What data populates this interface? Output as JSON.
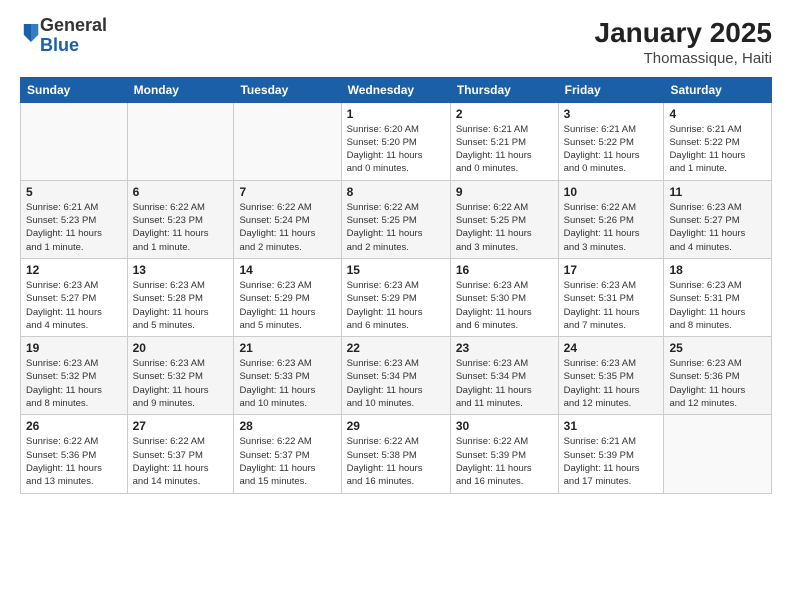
{
  "header": {
    "logo_general": "General",
    "logo_blue": "Blue",
    "title": "January 2025",
    "subtitle": "Thomassique, Haiti"
  },
  "days_of_week": [
    "Sunday",
    "Monday",
    "Tuesday",
    "Wednesday",
    "Thursday",
    "Friday",
    "Saturday"
  ],
  "weeks": [
    [
      {
        "day": "",
        "detail": ""
      },
      {
        "day": "",
        "detail": ""
      },
      {
        "day": "",
        "detail": ""
      },
      {
        "day": "1",
        "detail": "Sunrise: 6:20 AM\nSunset: 5:20 PM\nDaylight: 11 hours\nand 0 minutes."
      },
      {
        "day": "2",
        "detail": "Sunrise: 6:21 AM\nSunset: 5:21 PM\nDaylight: 11 hours\nand 0 minutes."
      },
      {
        "day": "3",
        "detail": "Sunrise: 6:21 AM\nSunset: 5:22 PM\nDaylight: 11 hours\nand 0 minutes."
      },
      {
        "day": "4",
        "detail": "Sunrise: 6:21 AM\nSunset: 5:22 PM\nDaylight: 11 hours\nand 1 minute."
      }
    ],
    [
      {
        "day": "5",
        "detail": "Sunrise: 6:21 AM\nSunset: 5:23 PM\nDaylight: 11 hours\nand 1 minute."
      },
      {
        "day": "6",
        "detail": "Sunrise: 6:22 AM\nSunset: 5:23 PM\nDaylight: 11 hours\nand 1 minute."
      },
      {
        "day": "7",
        "detail": "Sunrise: 6:22 AM\nSunset: 5:24 PM\nDaylight: 11 hours\nand 2 minutes."
      },
      {
        "day": "8",
        "detail": "Sunrise: 6:22 AM\nSunset: 5:25 PM\nDaylight: 11 hours\nand 2 minutes."
      },
      {
        "day": "9",
        "detail": "Sunrise: 6:22 AM\nSunset: 5:25 PM\nDaylight: 11 hours\nand 3 minutes."
      },
      {
        "day": "10",
        "detail": "Sunrise: 6:22 AM\nSunset: 5:26 PM\nDaylight: 11 hours\nand 3 minutes."
      },
      {
        "day": "11",
        "detail": "Sunrise: 6:23 AM\nSunset: 5:27 PM\nDaylight: 11 hours\nand 4 minutes."
      }
    ],
    [
      {
        "day": "12",
        "detail": "Sunrise: 6:23 AM\nSunset: 5:27 PM\nDaylight: 11 hours\nand 4 minutes."
      },
      {
        "day": "13",
        "detail": "Sunrise: 6:23 AM\nSunset: 5:28 PM\nDaylight: 11 hours\nand 5 minutes."
      },
      {
        "day": "14",
        "detail": "Sunrise: 6:23 AM\nSunset: 5:29 PM\nDaylight: 11 hours\nand 5 minutes."
      },
      {
        "day": "15",
        "detail": "Sunrise: 6:23 AM\nSunset: 5:29 PM\nDaylight: 11 hours\nand 6 minutes."
      },
      {
        "day": "16",
        "detail": "Sunrise: 6:23 AM\nSunset: 5:30 PM\nDaylight: 11 hours\nand 6 minutes."
      },
      {
        "day": "17",
        "detail": "Sunrise: 6:23 AM\nSunset: 5:31 PM\nDaylight: 11 hours\nand 7 minutes."
      },
      {
        "day": "18",
        "detail": "Sunrise: 6:23 AM\nSunset: 5:31 PM\nDaylight: 11 hours\nand 8 minutes."
      }
    ],
    [
      {
        "day": "19",
        "detail": "Sunrise: 6:23 AM\nSunset: 5:32 PM\nDaylight: 11 hours\nand 8 minutes."
      },
      {
        "day": "20",
        "detail": "Sunrise: 6:23 AM\nSunset: 5:32 PM\nDaylight: 11 hours\nand 9 minutes."
      },
      {
        "day": "21",
        "detail": "Sunrise: 6:23 AM\nSunset: 5:33 PM\nDaylight: 11 hours\nand 10 minutes."
      },
      {
        "day": "22",
        "detail": "Sunrise: 6:23 AM\nSunset: 5:34 PM\nDaylight: 11 hours\nand 10 minutes."
      },
      {
        "day": "23",
        "detail": "Sunrise: 6:23 AM\nSunset: 5:34 PM\nDaylight: 11 hours\nand 11 minutes."
      },
      {
        "day": "24",
        "detail": "Sunrise: 6:23 AM\nSunset: 5:35 PM\nDaylight: 11 hours\nand 12 minutes."
      },
      {
        "day": "25",
        "detail": "Sunrise: 6:23 AM\nSunset: 5:36 PM\nDaylight: 11 hours\nand 12 minutes."
      }
    ],
    [
      {
        "day": "26",
        "detail": "Sunrise: 6:22 AM\nSunset: 5:36 PM\nDaylight: 11 hours\nand 13 minutes."
      },
      {
        "day": "27",
        "detail": "Sunrise: 6:22 AM\nSunset: 5:37 PM\nDaylight: 11 hours\nand 14 minutes."
      },
      {
        "day": "28",
        "detail": "Sunrise: 6:22 AM\nSunset: 5:37 PM\nDaylight: 11 hours\nand 15 minutes."
      },
      {
        "day": "29",
        "detail": "Sunrise: 6:22 AM\nSunset: 5:38 PM\nDaylight: 11 hours\nand 16 minutes."
      },
      {
        "day": "30",
        "detail": "Sunrise: 6:22 AM\nSunset: 5:39 PM\nDaylight: 11 hours\nand 16 minutes."
      },
      {
        "day": "31",
        "detail": "Sunrise: 6:21 AM\nSunset: 5:39 PM\nDaylight: 11 hours\nand 17 minutes."
      },
      {
        "day": "",
        "detail": ""
      }
    ]
  ]
}
